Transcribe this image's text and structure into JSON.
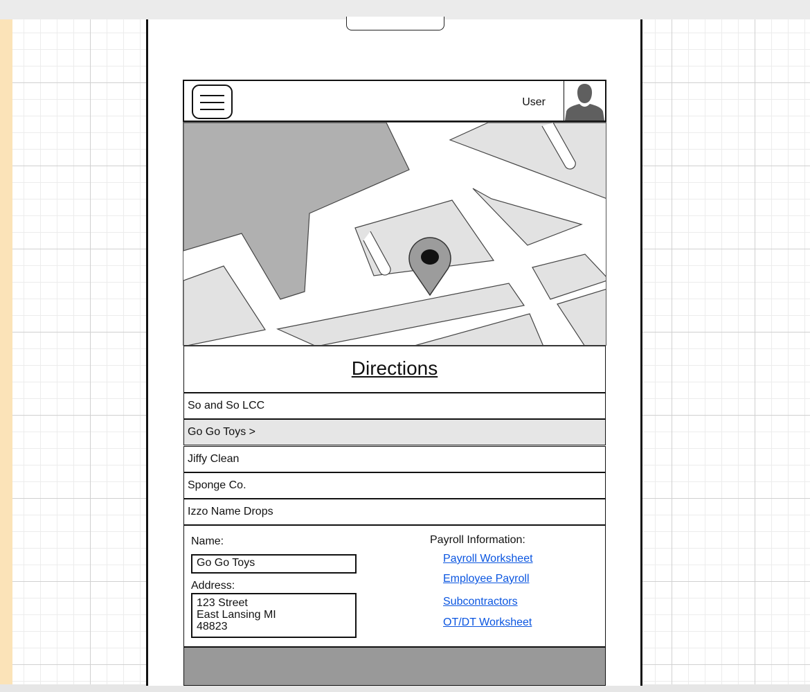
{
  "header": {
    "user_label": "User"
  },
  "directions": {
    "title": "Directions"
  },
  "companies": [
    {
      "label": "So and So LCC",
      "selected": false
    },
    {
      "label": "Go Go Toys >",
      "selected": true
    },
    {
      "label": "Jiffy Clean",
      "selected": false
    },
    {
      "label": "Sponge Co.",
      "selected": false
    },
    {
      "label": "Izzo Name Drops",
      "selected": false
    }
  ],
  "details": {
    "name_label": "Name:",
    "name_value": "Go Go Toys",
    "address_label": "Address:",
    "address_lines": [
      "123 Street",
      "East Lansing MI",
      "48823"
    ],
    "payroll_heading": "Payroll Information:",
    "payroll_links": [
      "Payroll Worksheet",
      "Employee Payroll",
      "Subcontractors",
      "OT/DT Worksheet"
    ]
  },
  "colors": {
    "link": "#0a55e0",
    "selected_row": "#e6e6e6",
    "map_block": "#b0b0b0",
    "map_street": "#ffffff",
    "map_ground": "#e2e2e2",
    "footer": "#999999"
  },
  "icons": {
    "menu": "hamburger-menu-icon",
    "avatar": "user-silhouette-icon",
    "map_pin": "map-pin-icon"
  }
}
